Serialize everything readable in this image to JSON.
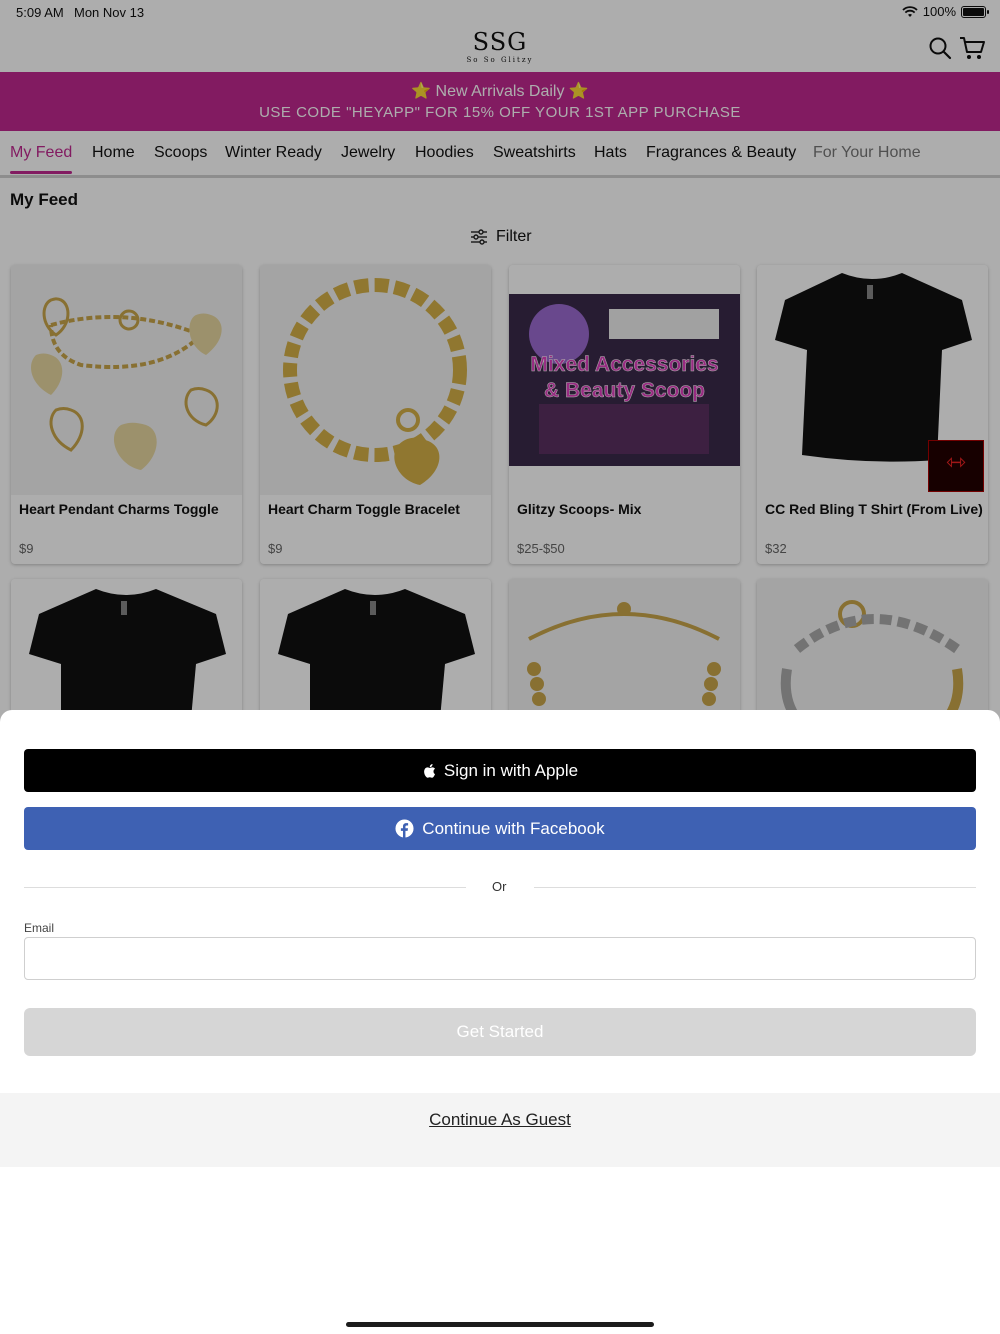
{
  "status_bar": {
    "time": "5:09 AM",
    "date": "Mon Nov 13",
    "battery": "100%"
  },
  "header": {
    "logo": "SSG",
    "logo_sub": "So So Glitzy"
  },
  "promo": {
    "line1": "⭐ New Arrivals Daily ⭐",
    "line2": "USE CODE \"HEYAPP\" FOR 15% OFF YOUR 1ST APP PURCHASE",
    "color": "#c0288f"
  },
  "tabs": [
    "My Feed",
    "Home",
    "Scoops",
    "Winter Ready",
    "Jewelry",
    "Hoodies",
    "Sweatshirts",
    "Hats",
    "Fragrances & Beauty",
    "For Your Home"
  ],
  "feed": {
    "title": "My Feed",
    "filter_label": "Filter",
    "products": [
      {
        "name": "Heart Pendant Charms Toggle",
        "price": "$9"
      },
      {
        "name": "Heart Charm Toggle Bracelet",
        "price": "$9"
      },
      {
        "name": "Glitzy Scoops- Mix",
        "price": "$25-$50",
        "image_text_1": "Mixed Accessories",
        "image_text_2": "& Beauty Scoop"
      },
      {
        "name": "CC Red Bling T Shirt (From Live)",
        "price": "$32"
      }
    ]
  },
  "sheet": {
    "apple_label": "Sign in with Apple",
    "facebook_label": "Continue with Facebook",
    "or_label": "Or",
    "email_label": "Email",
    "email_value": "",
    "get_started_label": "Get Started",
    "guest_label": "Continue As Guest",
    "facebook_color": "#3e61b3"
  }
}
